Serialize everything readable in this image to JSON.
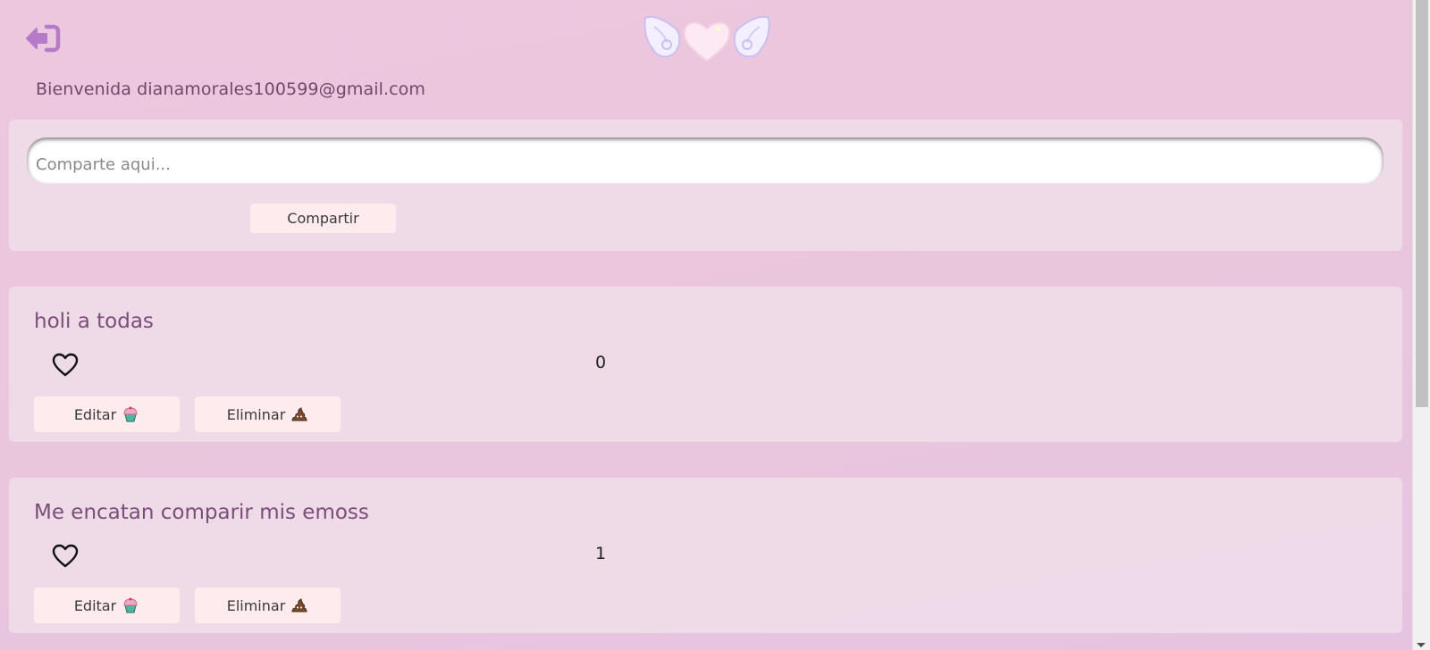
{
  "header": {
    "logout_icon": "sign-out-icon",
    "logo": "angel-heart-logo",
    "welcome_text": "Bienvenida dianamorales100599@gmail.com"
  },
  "share": {
    "placeholder": "Comparte aqui...",
    "button_label": "Compartir"
  },
  "posts": [
    {
      "text": "holi a todas",
      "likes": "0",
      "like_icon": "heart-outline-icon",
      "edit_label": "Editar",
      "edit_icon": "cupcake-icon",
      "delete_label": "Eliminar",
      "delete_icon": "poop-icon"
    },
    {
      "text": "Me encatan comparir mis emoss",
      "likes": "1",
      "like_icon": "heart-outline-icon",
      "edit_label": "Editar",
      "edit_icon": "cupcake-icon",
      "delete_label": "Eliminar",
      "delete_icon": "poop-icon"
    }
  ],
  "colors": {
    "accent": "#b57bc8",
    "button_bg": "#fdebee",
    "panel_bg": "#f0deea",
    "text": "#7b4d79"
  }
}
